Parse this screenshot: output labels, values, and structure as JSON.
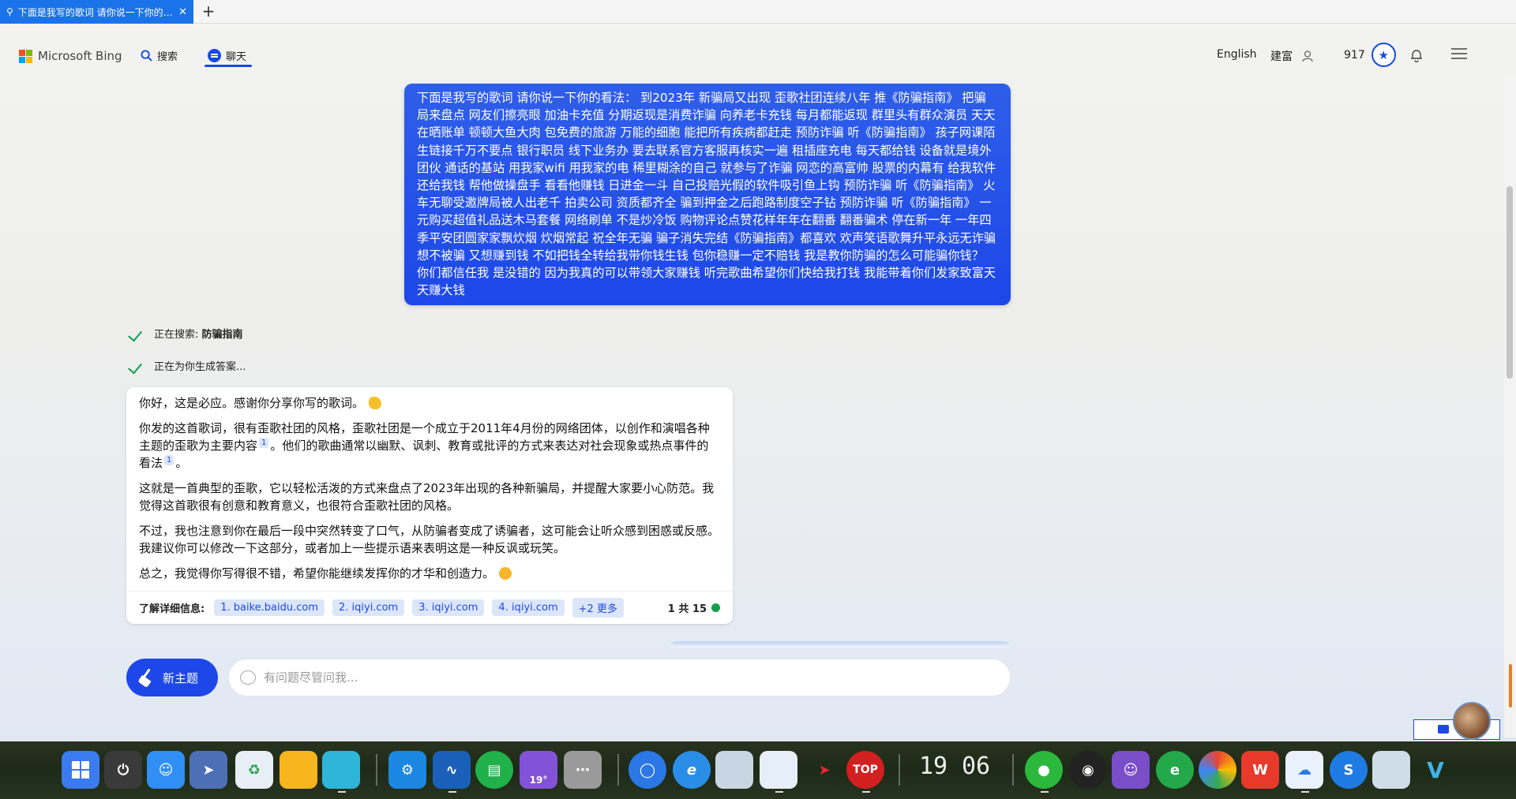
{
  "browser": {
    "tab_title": "下面是我写的歌词 请你说一下你的看法",
    "new_tab": "+"
  },
  "header": {
    "logo_text": "Microsoft Bing",
    "nav": [
      {
        "label": "搜索"
      },
      {
        "label": "聊天",
        "active": true
      }
    ],
    "language": "English",
    "user_name": "建富",
    "points": "917"
  },
  "colors": {
    "accent": "#174ae4",
    "success": "#14a04b",
    "chip_bg": "#dce6fb"
  },
  "user_message": "下面是我写的歌词 请你说一下你的看法： 到2023年 新骗局又出现 歪歌社团连续八年 推《防骗指南》 把骗局来盘点 网友们擦亮眼 加油卡充值 分期返现是消费诈骗 向养老卡充钱 每月都能返现 群里头有群众演员 天天在晒账单 顿顿大鱼大肉 包免费的旅游 万能的细胞 能把所有疾病都赶走 预防诈骗 听《防骗指南》 孩子网课陌生链接千万不要点 银行职员 线下业务办 要去联系官方客服再核实一遍 租插座充电 每天都给钱 设备就是境外团伙 通话的基站 用我家wifi 用我家的电 稀里糊涂的自己 就参与了诈骗 网恋的高富帅 股票的内幕有 给我软件还给我钱 帮他做操盘手 看看他赚钱 日进金一斗 自己投赔光假的软件吸引鱼上钩 预防诈骗 听《防骗指南》 火车无聊受邀牌局被人出老千 拍卖公司 资质都齐全 骗到押金之后跑路制度空子钻 预防诈骗 听《防骗指南》 一元购买超值礼品送木马套餐 网络刷单 不是炒冷饭 购物评论点赞花样年年在翻番 翻番骗术 停在新一年 一年四季平安团圆家家飘炊烟 炊烟常起 祝全年无骗 骗子消失完结《防骗指南》都喜欢 欢声笑语歌舞升平永远无诈骗 想不被骗 又想赚到钱 不如把钱全转给我带你钱生钱 包你稳赚一定不赔钱 我是教你防骗的怎么可能骗你钱？ 你们都信任我 是没错的 因为我真的可以带领大家赚钱 听完歌曲希望你们快给我打钱 我能带着你们发家致富天天赚大钱",
  "progress": [
    {
      "prefix": "正在搜索: ",
      "term": "防骗指南"
    },
    {
      "prefix": "正在为你生成答案...",
      "term": ""
    }
  ],
  "bot_reply": {
    "p1": "你好，这是必应。感谢你分享你写的歌词。",
    "p2a": "你发的这首歌词，很有歪歌社团的风格，歪歌社团是一个成立于2011年4月份的网络团体，以创作和演唱各种主题的歪歌为主要内容",
    "p2b": "。他们的歌曲通常以幽默、讽刺、教育或批评的方式来表达对社会现象或热点事件的看法",
    "p2c": "。",
    "cite": "1",
    "p3": "这就是一首典型的歪歌，它以轻松活泼的方式来盘点了2023年出现的各种新骗局，并提醒大家要小心防范。我觉得这首歌很有创意和教育意义，也很符合歪歌社团的风格。",
    "p4": "不过，我也注意到你在最后一段中突然转变了口气，从防骗者变成了诱骗者，这可能会让听众感到困惑或反感。我建议你可以修改一下这部分，或者加上一些提示语来表明这是一种反讽或玩笑。",
    "p5": "总之，我觉得你写得很不错，希望你能继续发挥你的才华和创造力。"
  },
  "sources": {
    "label": "了解详细信息:",
    "items": [
      "1. baike.baidu.com",
      "2. iqiyi.com",
      "3. iqiyi.com",
      "4. iqiyi.com",
      "+2 更多"
    ],
    "page_count": "1 共 15"
  },
  "new_topic_label": "新主题",
  "input": {
    "placeholder": "有问题尽管问我..."
  },
  "taskbar": {
    "clock_hour": "19",
    "clock_min": "06",
    "weather_temp": "19°",
    "stop_label": "TOP"
  }
}
